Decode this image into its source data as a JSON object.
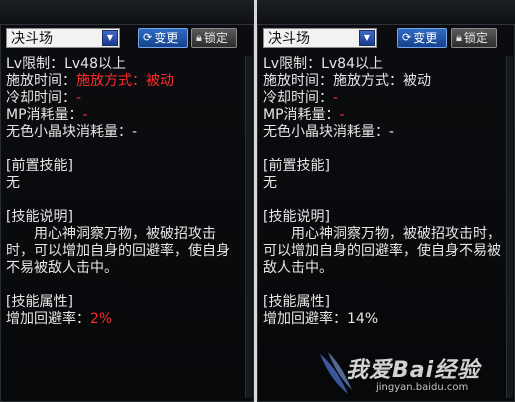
{
  "colors": {
    "panel_bg": "#0a0c0f",
    "value_red": "#ff2a2a",
    "text": "#e6e6e6",
    "accent_blue": "#2f6bc4"
  },
  "panels": [
    {
      "dropdown": {
        "value": "决斗场"
      },
      "change_button": {
        "icon": "refresh-icon",
        "label": "变更"
      },
      "lock_button": {
        "icon": "lock-icon",
        "label": "锁定"
      },
      "lv_label": "Lv限制：",
      "lv_value": "Lv48以上",
      "cast_time_label": "施放时间：",
      "cast_time_value": "施放方式：被动",
      "cooldown_label": "冷却时间：",
      "cooldown_value": "-",
      "mp_label": "MP消耗量：",
      "mp_value": "-",
      "crystal_label": "无色小晶块消耗量：",
      "crystal_value": "-",
      "prereq_header": "[前置技能]",
      "prereq_value": "无",
      "desc_header": "[技能说明]",
      "desc_text": "　　用心神洞察万物，被破招攻击时，可以增加自身的回避率，使自身不易被敌人击中。",
      "attr_header": "[技能属性]",
      "attr_label": "增加回避率：",
      "attr_value": "2%"
    },
    {
      "dropdown": {
        "value": "决斗场"
      },
      "change_button": {
        "icon": "refresh-icon",
        "label": "变更"
      },
      "lock_button": {
        "icon": "lock-icon",
        "label": "锁定"
      },
      "lv_label": "Lv限制：",
      "lv_value": "Lv84以上",
      "cast_time_label": "施放时间：",
      "cast_time_value": "施放方式：被动",
      "cooldown_label": "冷却时间：",
      "cooldown_value": "-",
      "mp_label": "MP消耗量：",
      "mp_value": "-",
      "crystal_label": "无色小晶块消耗量：",
      "crystal_value": "-",
      "prereq_header": "[前置技能]",
      "prereq_value": "无",
      "desc_header": "[技能说明]",
      "desc_text": "　　用心神洞察万物，被破招攻击时，可以增加自身的回避率，使自身不易被敌人击中。",
      "attr_header": "[技能属性]",
      "attr_label": "增加回避率：",
      "attr_value": "14%"
    }
  ],
  "watermark": {
    "main": "我爱Bai经验",
    "sub": "jingyan.baidu.com"
  }
}
